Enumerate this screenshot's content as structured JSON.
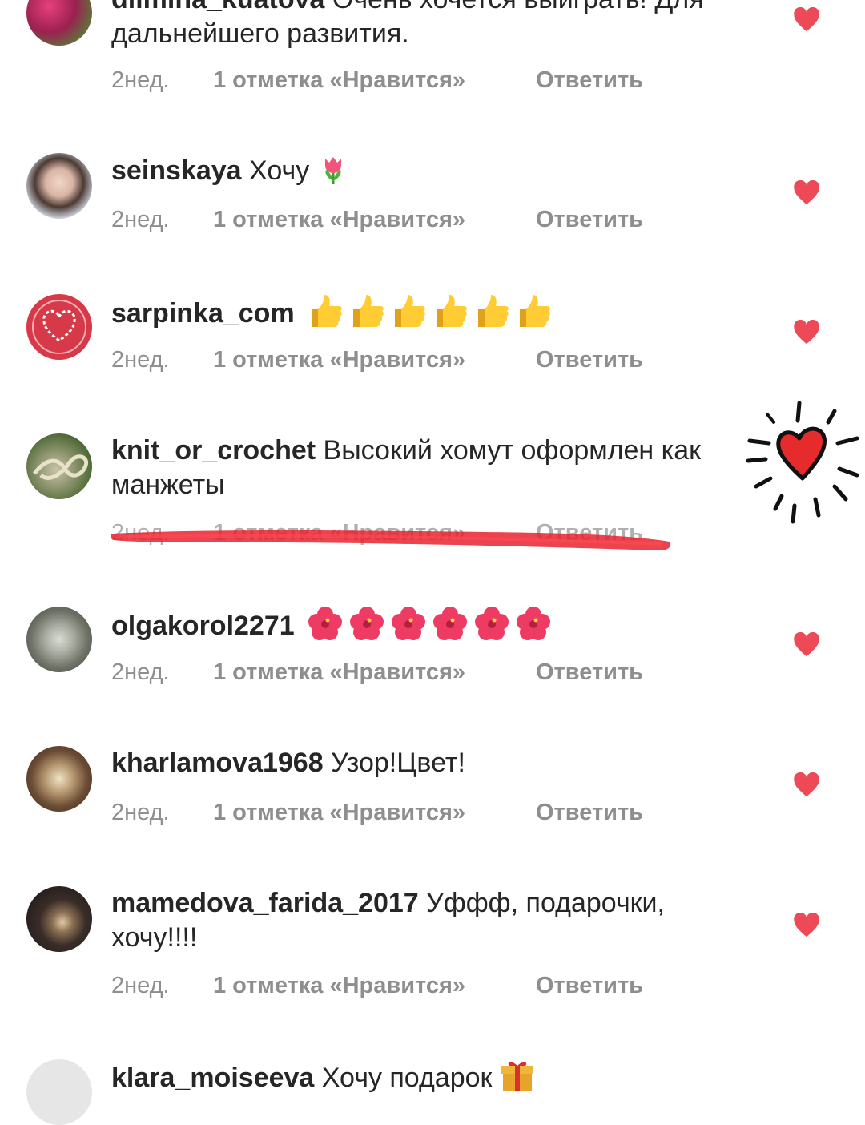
{
  "colors": {
    "heart": "#ed4956",
    "meta": "#8e8e8e",
    "text": "#262626",
    "marker": "#e8232f"
  },
  "comments": [
    {
      "username": "dilmina_kuatova",
      "text": "Очень хочется выиграть! Для дальнейшего развития.",
      "time": "2нед.",
      "likes": "1 отметка «Нравится»",
      "reply": "Ответить"
    },
    {
      "username": "seinskaya",
      "text": "Хочу",
      "emoji": "tulip",
      "time": "2нед.",
      "likes": "1 отметка «Нравится»",
      "reply": "Ответить"
    },
    {
      "username": "sarpinka_com",
      "text": "",
      "emoji": "thumbs-up x6",
      "time": "2нед.",
      "likes": "1 отметка «Нравится»",
      "reply": "Ответить"
    },
    {
      "username": "knit_or_crochet",
      "text": "Высокий хомут оформлен как манжеты",
      "time": "2нед.",
      "likes": "1 отметка «Нравится»",
      "reply": "Ответить",
      "struck_through": true
    },
    {
      "username": "olgakorol2271",
      "text": "",
      "emoji": "hibiscus x6",
      "time": "2нед.",
      "likes": "1 отметка «Нравится»",
      "reply": "Ответить"
    },
    {
      "username": "kharlamova1968",
      "text": "Узор!Цвет!",
      "time": "2нед.",
      "likes": "1 отметка «Нравится»",
      "reply": "Ответить"
    },
    {
      "username": "mamedova_farida_2017",
      "text": "Уффф, подарочки, хочу!!!!",
      "time": "2нед.",
      "likes": "1 отметка «Нравится»",
      "reply": "Ответить"
    },
    {
      "username": "klara_moiseeva",
      "text": "Хочу подарок",
      "emoji": "gift"
    }
  ],
  "icons": {
    "like": "heart-icon",
    "doodle": "hand-drawn-heart-icon"
  }
}
